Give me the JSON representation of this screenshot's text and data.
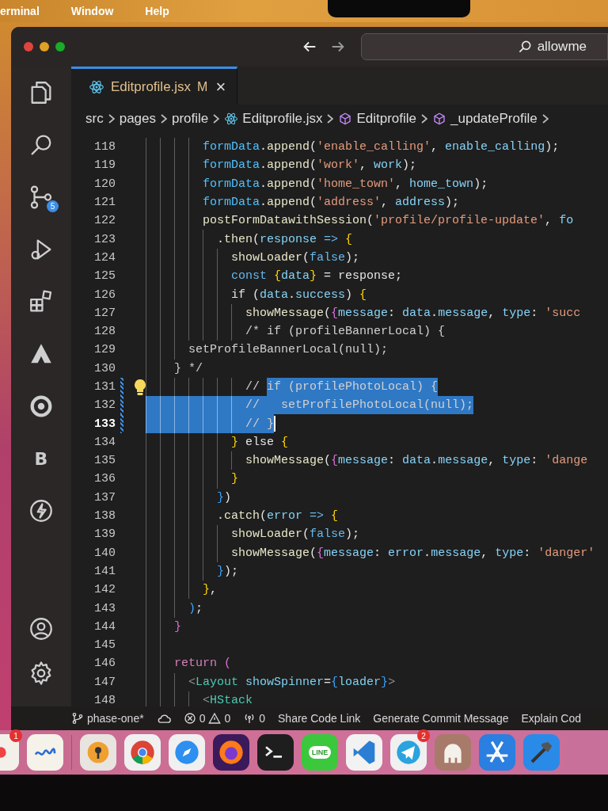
{
  "menu_bar": {
    "items": [
      "erminal",
      "Window",
      "Help"
    ]
  },
  "window": {
    "search": {
      "value": "allowme"
    }
  },
  "activity_bar": {
    "items": [
      {
        "kind": "explorer"
      },
      {
        "kind": "search"
      },
      {
        "kind": "source-control",
        "badge": "5"
      },
      {
        "kind": "run-debug"
      },
      {
        "kind": "extensions"
      },
      {
        "kind": "triangle-logo"
      },
      {
        "kind": "ring-logo"
      },
      {
        "kind": "letter",
        "label": "B"
      },
      {
        "kind": "lightning"
      }
    ],
    "bottom_items": [
      {
        "kind": "account"
      },
      {
        "kind": "settings"
      }
    ]
  },
  "tabs": [
    {
      "label": "Editprofile.jsx",
      "status": "M",
      "close": "×",
      "selected": true
    }
  ],
  "breadcrumb": [
    {
      "label": "src",
      "kind": "folder"
    },
    {
      "label": "pages",
      "kind": "folder"
    },
    {
      "label": "profile",
      "kind": "folder"
    },
    {
      "label": "Editprofile.jsx",
      "kind": "react-file"
    },
    {
      "label": "Editprofile",
      "kind": "symbol"
    },
    {
      "label": "_updateProfile",
      "kind": "symbol"
    }
  ],
  "editor": {
    "lines": [
      {
        "number": "118",
        "current": false,
        "modified": false,
        "guides": [
          {
            "selected": false
          },
          {
            "selected": false
          },
          {
            "selected": false
          },
          {
            "selected": false
          }
        ],
        "tokens": [
          {
            "text": "formData",
            "kind": "obj"
          },
          {
            "text": ".",
            "kind": "p"
          },
          {
            "text": "append",
            "kind": "fn"
          },
          {
            "text": "(",
            "kind": "p"
          },
          {
            "text": "'enable_calling'",
            "kind": "str"
          },
          {
            "text": ", ",
            "kind": "p"
          },
          {
            "text": "enable_calling",
            "kind": "var"
          },
          {
            "text": ");",
            "kind": "p"
          }
        ]
      },
      {
        "number": "119",
        "current": false,
        "modified": false,
        "guides": [
          {
            "selected": false
          },
          {
            "selected": false
          },
          {
            "selected": false
          },
          {
            "selected": false
          }
        ],
        "tokens": [
          {
            "text": "formData",
            "kind": "obj"
          },
          {
            "text": ".",
            "kind": "p"
          },
          {
            "text": "append",
            "kind": "fn"
          },
          {
            "text": "(",
            "kind": "p"
          },
          {
            "text": "'work'",
            "kind": "str"
          },
          {
            "text": ", ",
            "kind": "p"
          },
          {
            "text": "work",
            "kind": "var"
          },
          {
            "text": ");",
            "kind": "p"
          }
        ]
      },
      {
        "number": "120",
        "current": false,
        "modified": false,
        "guides": [
          {
            "selected": false
          },
          {
            "selected": false
          },
          {
            "selected": false
          },
          {
            "selected": false
          }
        ],
        "tokens": [
          {
            "text": "formData",
            "kind": "obj"
          },
          {
            "text": ".",
            "kind": "p"
          },
          {
            "text": "append",
            "kind": "fn"
          },
          {
            "text": "(",
            "kind": "p"
          },
          {
            "text": "'home_town'",
            "kind": "str"
          },
          {
            "text": ", ",
            "kind": "p"
          },
          {
            "text": "home_town",
            "kind": "var"
          },
          {
            "text": ");",
            "kind": "p"
          }
        ]
      },
      {
        "number": "121",
        "current": false,
        "modified": false,
        "guides": [
          {
            "selected": false
          },
          {
            "selected": false
          },
          {
            "selected": false
          },
          {
            "selected": false
          }
        ],
        "tokens": [
          {
            "text": "formData",
            "kind": "obj"
          },
          {
            "text": ".",
            "kind": "p"
          },
          {
            "text": "append",
            "kind": "fn"
          },
          {
            "text": "(",
            "kind": "p"
          },
          {
            "text": "'address'",
            "kind": "str"
          },
          {
            "text": ", ",
            "kind": "p"
          },
          {
            "text": "address",
            "kind": "var"
          },
          {
            "text": ");",
            "kind": "p"
          }
        ]
      },
      {
        "number": "122",
        "current": false,
        "modified": false,
        "guides": [
          {
            "selected": false
          },
          {
            "selected": false
          },
          {
            "selected": false
          },
          {
            "selected": false
          }
        ],
        "tokens": [
          {
            "text": "postFormDatawithSession",
            "kind": "fn"
          },
          {
            "text": "(",
            "kind": "p"
          },
          {
            "text": "'profile/profile-update'",
            "kind": "str"
          },
          {
            "text": ", ",
            "kind": "p"
          },
          {
            "text": "fo",
            "kind": "var"
          }
        ]
      },
      {
        "number": "123",
        "current": false,
        "modified": false,
        "guides": [
          {
            "selected": false
          },
          {
            "selected": false
          },
          {
            "selected": false
          },
          {
            "selected": false
          },
          {
            "selected": false
          }
        ],
        "tokens": [
          {
            "text": ".",
            "kind": "p"
          },
          {
            "text": "then",
            "kind": "fn"
          },
          {
            "text": "(",
            "kind": "p"
          },
          {
            "text": "response",
            "kind": "var"
          },
          {
            "text": " => ",
            "kind": "kw"
          },
          {
            "text": "{",
            "kind": "b1"
          }
        ]
      },
      {
        "number": "124",
        "current": false,
        "modified": false,
        "guides": [
          {
            "selected": false
          },
          {
            "selected": false
          },
          {
            "selected": false
          },
          {
            "selected": false
          },
          {
            "selected": false
          },
          {
            "selected": false
          }
        ],
        "tokens": [
          {
            "text": "showLoader",
            "kind": "fn"
          },
          {
            "text": "(",
            "kind": "p"
          },
          {
            "text": "false",
            "kind": "kw"
          },
          {
            "text": ");",
            "kind": "p"
          }
        ]
      },
      {
        "number": "125",
        "current": false,
        "modified": false,
        "guides": [
          {
            "selected": false
          },
          {
            "selected": false
          },
          {
            "selected": false
          },
          {
            "selected": false
          },
          {
            "selected": false
          },
          {
            "selected": false
          }
        ],
        "tokens": [
          {
            "text": "const ",
            "kind": "kw"
          },
          {
            "text": "{",
            "kind": "b1"
          },
          {
            "text": "data",
            "kind": "var"
          },
          {
            "text": "}",
            "kind": "b1"
          },
          {
            "text": " = response;",
            "kind": "p"
          }
        ]
      },
      {
        "number": "126",
        "current": false,
        "modified": false,
        "guides": [
          {
            "selected": false
          },
          {
            "selected": false
          },
          {
            "selected": false
          },
          {
            "selected": false
          },
          {
            "selected": false
          },
          {
            "selected": false
          }
        ],
        "tokens": [
          {
            "text": "if (",
            "kind": "p"
          },
          {
            "text": "data",
            "kind": "var"
          },
          {
            "text": ".",
            "kind": "p"
          },
          {
            "text": "success",
            "kind": "var"
          },
          {
            "text": ") ",
            "kind": "p"
          },
          {
            "text": "{",
            "kind": "b1"
          }
        ]
      },
      {
        "number": "127",
        "current": false,
        "modified": false,
        "guides": [
          {
            "selected": false
          },
          {
            "selected": false
          },
          {
            "selected": false
          },
          {
            "selected": false
          },
          {
            "selected": false
          },
          {
            "selected": false
          },
          {
            "selected": false
          }
        ],
        "tokens": [
          {
            "text": "showMessage",
            "kind": "fn"
          },
          {
            "text": "(",
            "kind": "p"
          },
          {
            "text": "{",
            "kind": "b2"
          },
          {
            "text": "message",
            "kind": "var"
          },
          {
            "text": ": ",
            "kind": "p"
          },
          {
            "text": "data",
            "kind": "var"
          },
          {
            "text": ".",
            "kind": "p"
          },
          {
            "text": "message",
            "kind": "var"
          },
          {
            "text": ", ",
            "kind": "p"
          },
          {
            "text": "type",
            "kind": "var"
          },
          {
            "text": ": ",
            "kind": "p"
          },
          {
            "text": "'succ",
            "kind": "str"
          }
        ]
      },
      {
        "number": "128",
        "current": false,
        "modified": false,
        "guides": [
          {
            "selected": false
          },
          {
            "selected": false
          },
          {
            "selected": false
          },
          {
            "selected": false
          },
          {
            "selected": false
          },
          {
            "selected": false
          },
          {
            "selected": false
          }
        ],
        "tokens": [
          {
            "text": "/* if (profileBannerLocal) {",
            "kind": "comment"
          }
        ]
      },
      {
        "number": "129",
        "current": false,
        "modified": false,
        "guides": [
          {
            "selected": false
          },
          {
            "selected": false
          },
          {
            "selected": false
          }
        ],
        "tokens": [
          {
            "text": "setProfileBannerLocal(null);",
            "kind": "comment"
          }
        ]
      },
      {
        "number": "130",
        "current": false,
        "modified": false,
        "guides": [
          {
            "selected": false
          },
          {
            "selected": false
          }
        ],
        "tokens": [
          {
            "text": "} */",
            "kind": "comment"
          }
        ]
      },
      {
        "number": "131",
        "current": false,
        "modified": true,
        "lightbulb": true,
        "guides": [
          {
            "selected": false
          },
          {
            "selected": false
          },
          {
            "selected": false
          },
          {
            "selected": false
          },
          {
            "selected": false
          },
          {
            "selected": false
          },
          {
            "selected": false
          }
        ],
        "tokens": [
          {
            "text": "// ",
            "kind": "comment",
            "selected": false
          },
          {
            "text": "if (profilePhotoLocal) {",
            "kind": "comment",
            "selected": true
          }
        ]
      },
      {
        "number": "132",
        "current": false,
        "modified": true,
        "guides": [
          {
            "selected": true
          },
          {
            "selected": true
          },
          {
            "selected": true
          },
          {
            "selected": true
          },
          {
            "selected": true
          },
          {
            "selected": true
          },
          {
            "selected": true
          }
        ],
        "tokens": [
          {
            "text": "//   setProfilePhotoLocal(null);",
            "kind": "comment",
            "selected": true
          }
        ]
      },
      {
        "number": "133",
        "current": true,
        "modified": true,
        "guides": [
          {
            "selected": true
          },
          {
            "selected": true
          },
          {
            "selected": true
          },
          {
            "selected": true
          },
          {
            "selected": true
          },
          {
            "selected": true
          },
          {
            "selected": true
          }
        ],
        "tokens": [
          {
            "text": "// }",
            "kind": "comment",
            "selected": true
          }
        ]
      },
      {
        "number": "134",
        "current": false,
        "modified": false,
        "guides": [
          {
            "selected": false
          },
          {
            "selected": false
          },
          {
            "selected": false
          },
          {
            "selected": false
          },
          {
            "selected": false
          },
          {
            "selected": false
          }
        ],
        "tokens": [
          {
            "text": "}",
            "kind": "b1"
          },
          {
            "text": " else ",
            "kind": "p"
          },
          {
            "text": "{",
            "kind": "b1"
          }
        ]
      },
      {
        "number": "135",
        "current": false,
        "modified": false,
        "guides": [
          {
            "selected": false
          },
          {
            "selected": false
          },
          {
            "selected": false
          },
          {
            "selected": false
          },
          {
            "selected": false
          },
          {
            "selected": false
          },
          {
            "selected": false
          }
        ],
        "tokens": [
          {
            "text": "showMessage",
            "kind": "fn"
          },
          {
            "text": "(",
            "kind": "p"
          },
          {
            "text": "{",
            "kind": "b2"
          },
          {
            "text": "message",
            "kind": "var"
          },
          {
            "text": ": ",
            "kind": "p"
          },
          {
            "text": "data",
            "kind": "var"
          },
          {
            "text": ".",
            "kind": "p"
          },
          {
            "text": "message",
            "kind": "var"
          },
          {
            "text": ", ",
            "kind": "p"
          },
          {
            "text": "type",
            "kind": "var"
          },
          {
            "text": ": ",
            "kind": "p"
          },
          {
            "text": "'dange",
            "kind": "str"
          }
        ]
      },
      {
        "number": "136",
        "current": false,
        "modified": false,
        "guides": [
          {
            "selected": false
          },
          {
            "selected": false
          },
          {
            "selected": false
          },
          {
            "selected": false
          },
          {
            "selected": false
          },
          {
            "selected": false
          }
        ],
        "tokens": [
          {
            "text": "}",
            "kind": "b1"
          }
        ]
      },
      {
        "number": "137",
        "current": false,
        "modified": false,
        "guides": [
          {
            "selected": false
          },
          {
            "selected": false
          },
          {
            "selected": false
          },
          {
            "selected": false
          },
          {
            "selected": false
          }
        ],
        "tokens": [
          {
            "text": "}",
            "kind": "b3"
          },
          {
            "text": ")",
            "kind": "p"
          }
        ]
      },
      {
        "number": "138",
        "current": false,
        "modified": false,
        "guides": [
          {
            "selected": false
          },
          {
            "selected": false
          },
          {
            "selected": false
          },
          {
            "selected": false
          },
          {
            "selected": false
          }
        ],
        "tokens": [
          {
            "text": ".",
            "kind": "p"
          },
          {
            "text": "catch",
            "kind": "fn"
          },
          {
            "text": "(",
            "kind": "p"
          },
          {
            "text": "error",
            "kind": "var"
          },
          {
            "text": " => ",
            "kind": "kw"
          },
          {
            "text": "{",
            "kind": "b1"
          }
        ]
      },
      {
        "number": "139",
        "current": false,
        "modified": false,
        "guides": [
          {
            "selected": false
          },
          {
            "selected": false
          },
          {
            "selected": false
          },
          {
            "selected": false
          },
          {
            "selected": false
          },
          {
            "selected": false
          }
        ],
        "tokens": [
          {
            "text": "showLoader",
            "kind": "fn"
          },
          {
            "text": "(",
            "kind": "p"
          },
          {
            "text": "false",
            "kind": "kw"
          },
          {
            "text": ");",
            "kind": "p"
          }
        ]
      },
      {
        "number": "140",
        "current": false,
        "modified": false,
        "guides": [
          {
            "selected": false
          },
          {
            "selected": false
          },
          {
            "selected": false
          },
          {
            "selected": false
          },
          {
            "selected": false
          },
          {
            "selected": false
          }
        ],
        "tokens": [
          {
            "text": "showMessage",
            "kind": "fn"
          },
          {
            "text": "(",
            "kind": "p"
          },
          {
            "text": "{",
            "kind": "b2"
          },
          {
            "text": "message",
            "kind": "var"
          },
          {
            "text": ": ",
            "kind": "p"
          },
          {
            "text": "error",
            "kind": "var"
          },
          {
            "text": ".",
            "kind": "p"
          },
          {
            "text": "message",
            "kind": "var"
          },
          {
            "text": ", ",
            "kind": "p"
          },
          {
            "text": "type",
            "kind": "var"
          },
          {
            "text": ": ",
            "kind": "p"
          },
          {
            "text": "'danger'",
            "kind": "str"
          }
        ]
      },
      {
        "number": "141",
        "current": false,
        "modified": false,
        "guides": [
          {
            "selected": false
          },
          {
            "selected": false
          },
          {
            "selected": false
          },
          {
            "selected": false
          },
          {
            "selected": false
          }
        ],
        "tokens": [
          {
            "text": "}",
            "kind": "b3"
          },
          {
            "text": ");",
            "kind": "p"
          }
        ]
      },
      {
        "number": "142",
        "current": false,
        "modified": false,
        "guides": [
          {
            "selected": false
          },
          {
            "selected": false
          },
          {
            "selected": false
          },
          {
            "selected": false
          }
        ],
        "tokens": [
          {
            "text": "}",
            "kind": "b1"
          },
          {
            "text": ",",
            "kind": "p"
          }
        ]
      },
      {
        "number": "143",
        "current": false,
        "modified": false,
        "guides": [
          {
            "selected": false
          },
          {
            "selected": false
          },
          {
            "selected": false
          }
        ],
        "tokens": [
          {
            "text": ")",
            "kind": "b3"
          },
          {
            "text": ";",
            "kind": "p"
          }
        ]
      },
      {
        "number": "144",
        "current": false,
        "modified": false,
        "guides": [
          {
            "selected": false
          },
          {
            "selected": false
          }
        ],
        "tokens": [
          {
            "text": "}",
            "kind": "b2"
          }
        ]
      },
      {
        "number": "145",
        "current": false,
        "modified": false,
        "guides": [
          {
            "selected": false
          },
          {
            "selected": false
          }
        ]
      },
      {
        "number": "146",
        "current": false,
        "modified": false,
        "guides": [
          {
            "selected": false
          },
          {
            "selected": false
          }
        ],
        "tokens": [
          {
            "text": "return ",
            "kind": "ctl"
          },
          {
            "text": "(",
            "kind": "b2"
          }
        ]
      },
      {
        "number": "147",
        "current": false,
        "modified": false,
        "guides": [
          {
            "selected": false
          },
          {
            "selected": false
          },
          {
            "selected": false
          }
        ],
        "tokens": [
          {
            "text": "<",
            "kind": "tagp"
          },
          {
            "text": "Layout ",
            "kind": "tag"
          },
          {
            "text": "showSpinner",
            "kind": "attr"
          },
          {
            "text": "=",
            "kind": "p"
          },
          {
            "text": "{",
            "kind": "b3"
          },
          {
            "text": "loader",
            "kind": "attr"
          },
          {
            "text": "}",
            "kind": "b3"
          },
          {
            "text": ">",
            "kind": "tagp"
          }
        ]
      },
      {
        "number": "148",
        "current": false,
        "modified": false,
        "guides": [
          {
            "selected": false
          },
          {
            "selected": false
          },
          {
            "selected": false
          },
          {
            "selected": false
          }
        ],
        "tokens": [
          {
            "text": "<",
            "kind": "tagp"
          },
          {
            "text": "HStack",
            "kind": "tag"
          }
        ]
      }
    ]
  },
  "status_bar": {
    "branch": "phase-one*",
    "errors": "0",
    "warnings": "0",
    "ports": "0",
    "items": [
      "Share Code Link",
      "Generate Commit Message",
      "Explain Cod"
    ]
  },
  "dock": {
    "items": [
      {
        "kind": "partial-app",
        "badge": "1"
      },
      {
        "kind": "squiggle-app"
      },
      {
        "kind": "separator"
      },
      {
        "kind": "keyhole-app"
      },
      {
        "kind": "chrome"
      },
      {
        "kind": "safari"
      },
      {
        "kind": "firefox"
      },
      {
        "kind": "terminal"
      },
      {
        "kind": "line",
        "label": "LINE"
      },
      {
        "kind": "vscode"
      },
      {
        "kind": "telegram",
        "badge": "2"
      },
      {
        "kind": "elephant"
      },
      {
        "kind": "xcode-blue"
      },
      {
        "kind": "xcode"
      }
    ]
  }
}
